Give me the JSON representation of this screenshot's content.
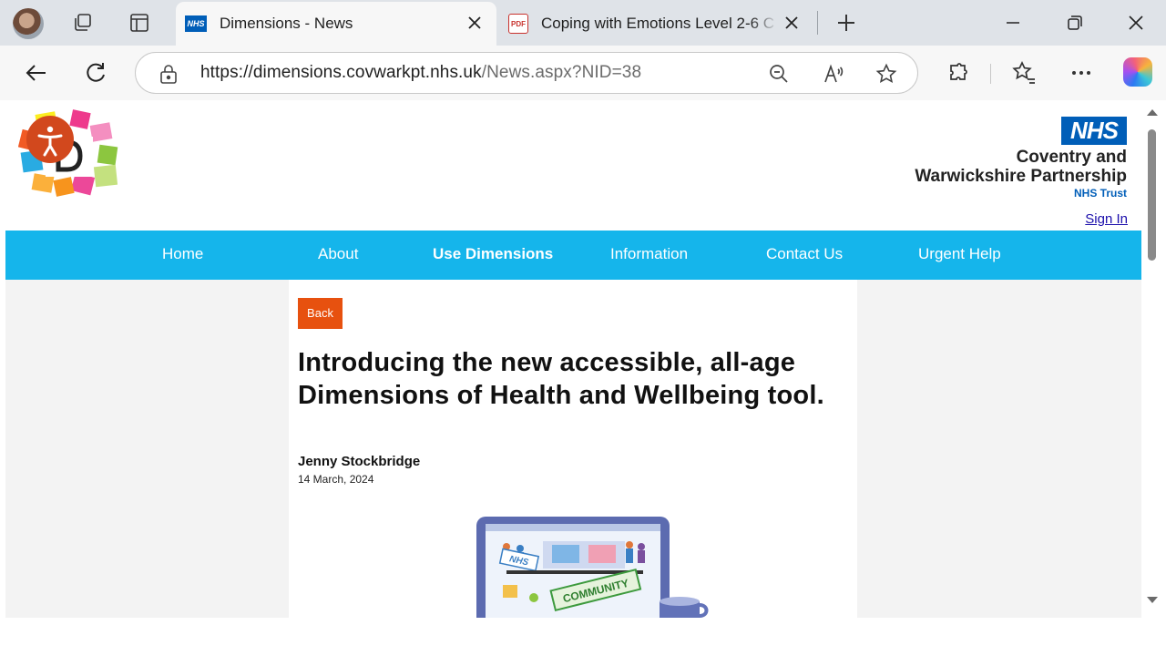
{
  "browser": {
    "tabs": [
      {
        "title": "Dimensions - News",
        "favicon": "NHS",
        "active": true
      },
      {
        "title": "Coping with Emotions Level 2-6 C",
        "favicon": "PDF",
        "active": false
      }
    ],
    "url_host": "https://dimensions.covwarkpt.nhs.uk",
    "url_path": "/News.aspx?NID=38"
  },
  "site": {
    "nhs_logo": "NHS",
    "trust_line1": "Coventry and",
    "trust_line2": "Warwickshire Partnership",
    "trust_line3": "NHS Trust",
    "sign_in": "Sign In",
    "nav": [
      "Home",
      "About",
      "Use Dimensions",
      "Information",
      "Contact Us",
      "Urgent Help"
    ],
    "active_nav": "Use Dimensions",
    "accent_blue": "#15b5eb",
    "accent_orange": "#e7510f"
  },
  "article": {
    "back_label": "Back",
    "title": "Introducing the new accessible, all-age Dimensions of Health and Wellbeing tool.",
    "author": "Jenny Stockbridge",
    "date": "14 March, 2024",
    "illustration_text_1": "NHS",
    "illustration_text_2": "COMMUNITY"
  }
}
